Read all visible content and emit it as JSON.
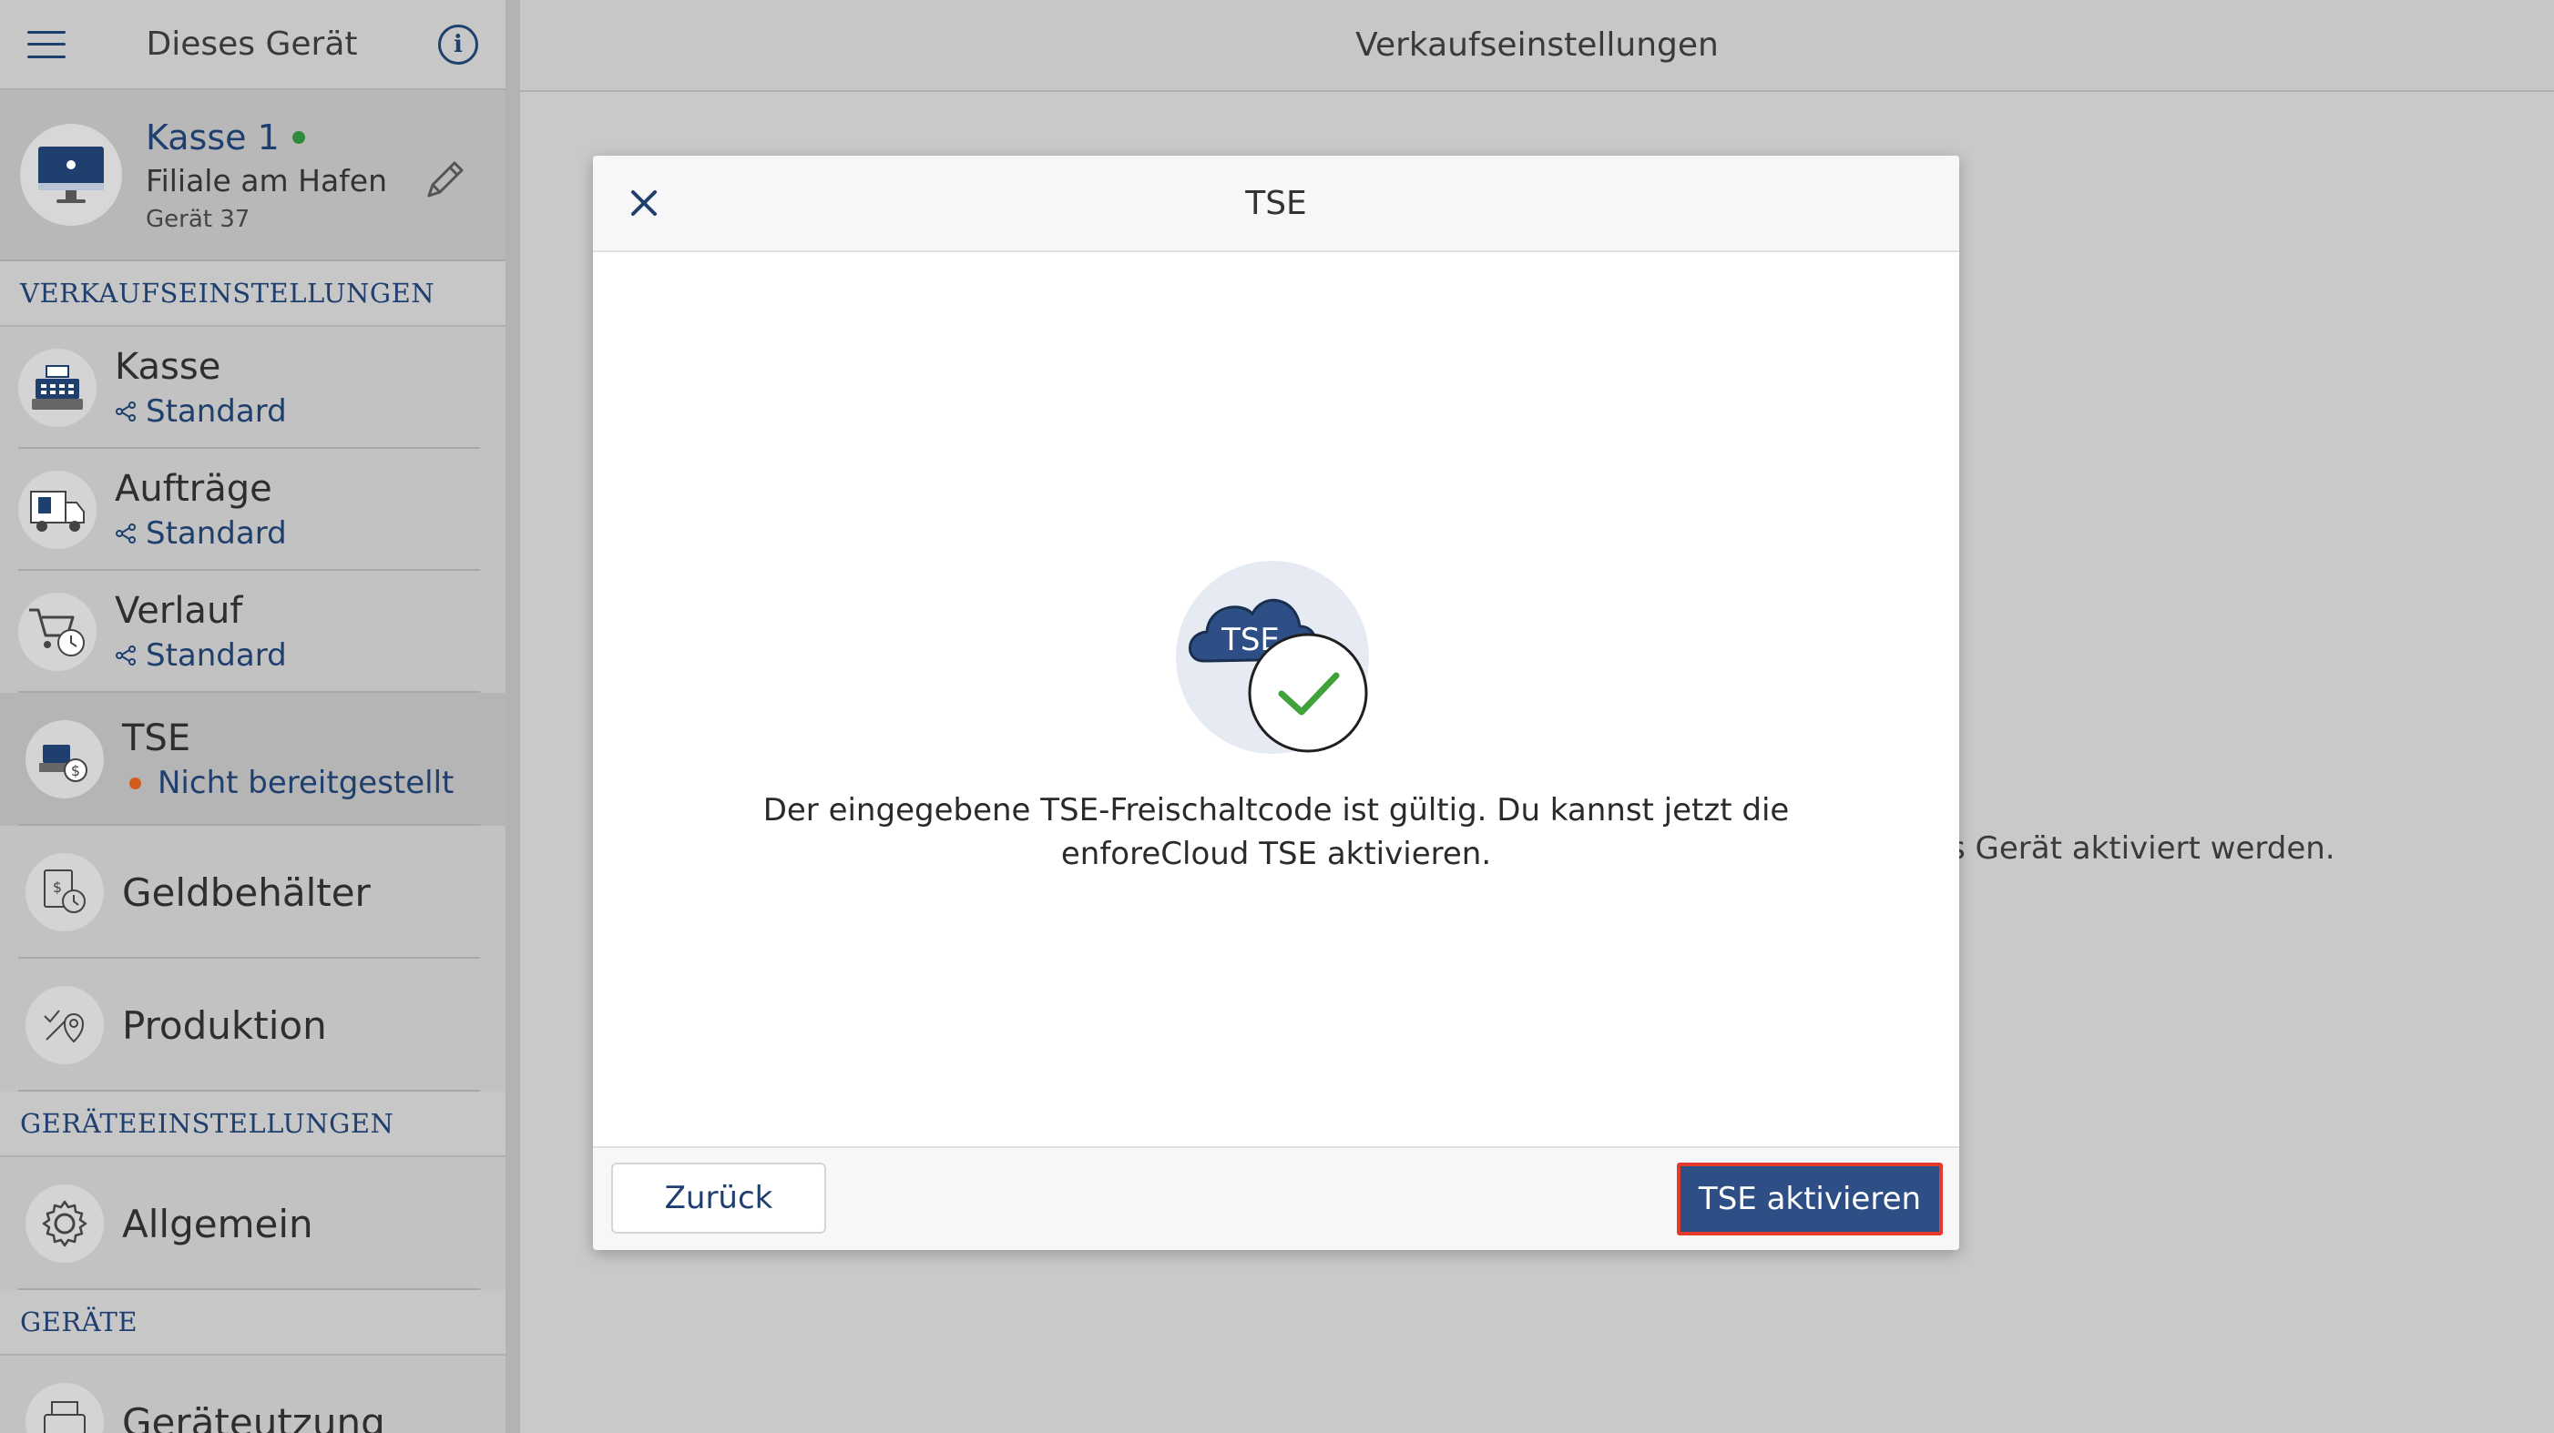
{
  "sidebar": {
    "header_title": "Dieses Gerät",
    "device": {
      "name": "Kasse 1",
      "branch": "Filiale am Hafen",
      "device_no": "Gerät 37"
    },
    "sections": {
      "sales": "VERKAUFSEINSTELLUNGEN",
      "device_settings": "GERÄTEEINSTELLUNGEN",
      "devices": "GERÄTE"
    },
    "items": [
      {
        "title": "Kasse",
        "subtitle": "Standard"
      },
      {
        "title": "Aufträge",
        "subtitle": "Standard"
      },
      {
        "title": "Verlauf",
        "subtitle": "Standard"
      },
      {
        "title": "TSE",
        "subtitle": "Nicht bereitgestellt"
      },
      {
        "title": "Geldbehälter"
      },
      {
        "title": "Produktion"
      },
      {
        "title": "Allgemein"
      },
      {
        "title": "Geräteutzung"
      }
    ]
  },
  "main": {
    "header_title": "Verkaufseinstellungen",
    "background_text": "s Gerät aktiviert werden."
  },
  "modal": {
    "title": "TSE",
    "illustration_label": "TSE",
    "message": "Der eingegebene TSE-Freischaltcode ist gültig. Du kannst jetzt die enforeCloud TSE aktivieren.",
    "back_label": "Zurück",
    "activate_label": "TSE aktivieren"
  },
  "colors": {
    "accent_blue": "#2d4f86",
    "status_green": "#2e8b3b",
    "status_orange": "#d35b1e",
    "highlight_red": "#e53b2c"
  }
}
